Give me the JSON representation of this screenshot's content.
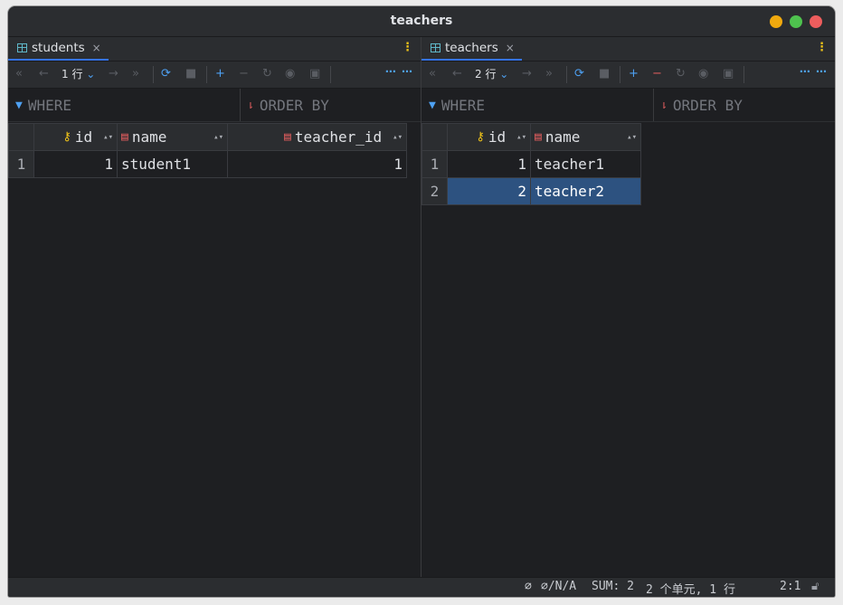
{
  "window": {
    "title": "teachers"
  },
  "colors": {
    "close": "#ed5d5d",
    "maximize": "#4ec24e",
    "minimize": "#f0a90e",
    "selection": "#2d5280"
  },
  "icons": {
    "filter": "filter-icon",
    "sort": "sort-icon",
    "primary_key": "key-icon",
    "column": "column-icon"
  },
  "left": {
    "tab": {
      "label": "students",
      "close": "×"
    },
    "toolbar": {
      "rows_label": "1 行",
      "more": "⋯ ⋯"
    },
    "filter": {
      "where": "WHERE",
      "order_by": "ORDER BY"
    },
    "columns": [
      "id",
      "name",
      "teacher_id"
    ],
    "rows": [
      {
        "num": "1",
        "id": "1",
        "name": "student1",
        "teacher_id": "1"
      }
    ]
  },
  "right": {
    "tab": {
      "label": "teachers",
      "close": "×"
    },
    "toolbar": {
      "rows_label": "2 行",
      "more": "⋯ ⋯"
    },
    "filter": {
      "where": "WHERE",
      "order_by": "ORDER BY"
    },
    "columns": [
      "id",
      "name"
    ],
    "rows": [
      {
        "num": "1",
        "id": "1",
        "name": "teacher1"
      },
      {
        "num": "2",
        "id": "2",
        "name": "teacher2"
      }
    ]
  },
  "status": {
    "null_icon": "⌀",
    "aggregate": "∅/N/A",
    "sum": "SUM: 2",
    "cells": "2 个单元, 1 行",
    "position": "2:1"
  }
}
